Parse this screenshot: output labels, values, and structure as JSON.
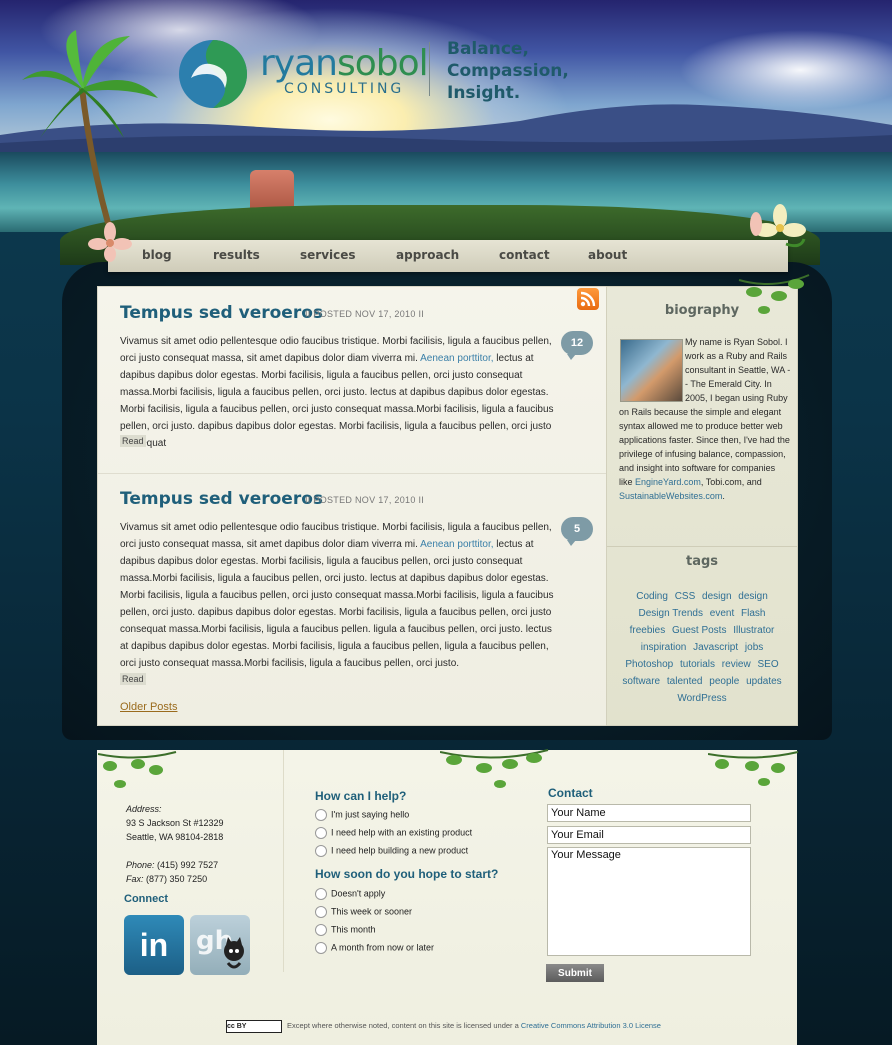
{
  "branding": {
    "name_part1": "ryan",
    "name_part2": "sobol",
    "subtitle": "CONSULTING",
    "tagline": [
      "Balance,",
      "Compassion,",
      "Insight."
    ]
  },
  "nav": {
    "items": [
      "blog",
      "results",
      "services",
      "approach",
      "contact",
      "about"
    ]
  },
  "posts": [
    {
      "title": "Tempus sed veroeros",
      "meta": "II  POSTED NOV 17, 2010  II",
      "comments": "12",
      "body_before_link": "Vivamus sit amet odio pellentesque odio faucibus tristique. Morbi facilisis, ligula a faucibus pellen, orci justo consequat massa, sit amet dapibus dolor diam viverra mi. ",
      "link": "Aenean porttitor,",
      "body_after_link": " lectus at dapibus dapibus dolor egestas. Morbi facilisis, ligula a faucibus pellen, orci justo consequat massa.Morbi facilisis, ligula a faucibus pellen, orci justo. lectus at dapibus dapibus dolor egestas. Morbi facilisis, ligula a faucibus pellen, orci justo consequat massa.Morbi facilisis, ligula a faucibus pellen, orci justo. dapibus dapibus dolor egestas. Morbi facilisis, ligula a faucibus pellen, orci justo consequat",
      "read_label": "Read"
    },
    {
      "title": "Tempus sed veroeros",
      "meta": "II  POSTED NOV 17, 2010  II",
      "comments": "5",
      "body_before_link": "Vivamus sit amet odio pellentesque odio faucibus tristique. Morbi facilisis, ligula a faucibus pellen, orci justo consequat massa, sit amet dapibus dolor diam viverra mi. ",
      "link": "Aenean porttitor,",
      "body_after_link": " lectus at dapibus dapibus dolor egestas. Morbi facilisis, ligula a faucibus pellen, orci justo consequat massa.Morbi facilisis, ligula a faucibus pellen, orci justo. lectus at dapibus dapibus dolor egestas. Morbi facilisis, ligula a faucibus pellen, orci justo consequat massa.Morbi facilisis, ligula a faucibus pellen, orci justo. dapibus dapibus dolor egestas. Morbi facilisis, ligula a faucibus pellen, orci justo consequat massa.Morbi facilisis, ligula a faucibus pellen. ligula a faucibus pellen, orci justo. lectus at dapibus dapibus dolor egestas. Morbi facilisis, ligula a faucibus pellen, ligula a faucibus pellen, orci justo consequat massa.Morbi facilisis, ligula a faucibus pellen, orci justo.",
      "read_label": "Read"
    }
  ],
  "older_posts": "Older Posts",
  "sidebar": {
    "bio_heading": "biography",
    "bio_text": "My name is Ryan Sobol. I work as a Ruby and Rails consultant in Seattle, WA -- The Emerald City. In 2005, I began using Ruby on Rails because the simple and elegant syntax allowed me to produce better web applications faster. Since then, I've had the privilege of infusing balance, compassion, and insight into software for companies like ",
    "bio_link1": "EngineYard.com",
    "bio_mid": ", Tobi.com, and ",
    "bio_link2": "SustainableWebsites.com",
    "bio_end": ".",
    "tags_heading": "tags",
    "tags": [
      "Coding",
      "CSS",
      "design",
      "design",
      "Design Trends",
      "event",
      "Flash",
      "freebies",
      "Guest Posts",
      "Illustrator",
      "inspiration",
      "Javascript",
      "jobs",
      "Photoshop",
      "tutorials",
      "review",
      "SEO",
      "software",
      "talented",
      "people",
      "updates",
      "WordPress"
    ]
  },
  "footer": {
    "address_label": "Address:",
    "address_line1": "93 S Jackson St #12329",
    "address_line2": "Seattle, WA 98104-2818",
    "phone_label": "Phone:",
    "phone": "(415) 992 7527",
    "fax_label": "Fax:",
    "fax": "(877) 350 7250",
    "connect_heading": "Connect",
    "linkedin_text": "in",
    "help_heading": "How can I help?",
    "help_options": [
      "I'm just saying hello",
      "I need help with an existing product",
      "I need help building a new product"
    ],
    "when_heading": "How soon do you hope to start?",
    "when_options": [
      "Doesn't apply",
      "This week or sooner",
      "This month",
      "A month from now or later"
    ],
    "contact_heading": "Contact",
    "name_placeholder": "Your Name",
    "email_placeholder": "Your Email",
    "message_placeholder": "Your Message",
    "submit_label": "Submit",
    "cc_badge": "cc BY",
    "license_before": "Except where otherwise noted, content on this site is licensed under a ",
    "license_link": "Creative Commons Attribution 3.0 License"
  },
  "colors": {
    "heading_blue": "#1f5f7a",
    "link_blue": "#2f6f94",
    "older_posts_brown": "#9a6b1d",
    "rss_orange": "#f27a1a"
  },
  "icons": {
    "rss": "rss-icon",
    "comments": "speech-bubble-icon",
    "linkedin": "linkedin-icon",
    "github": "github-octocat-icon"
  }
}
